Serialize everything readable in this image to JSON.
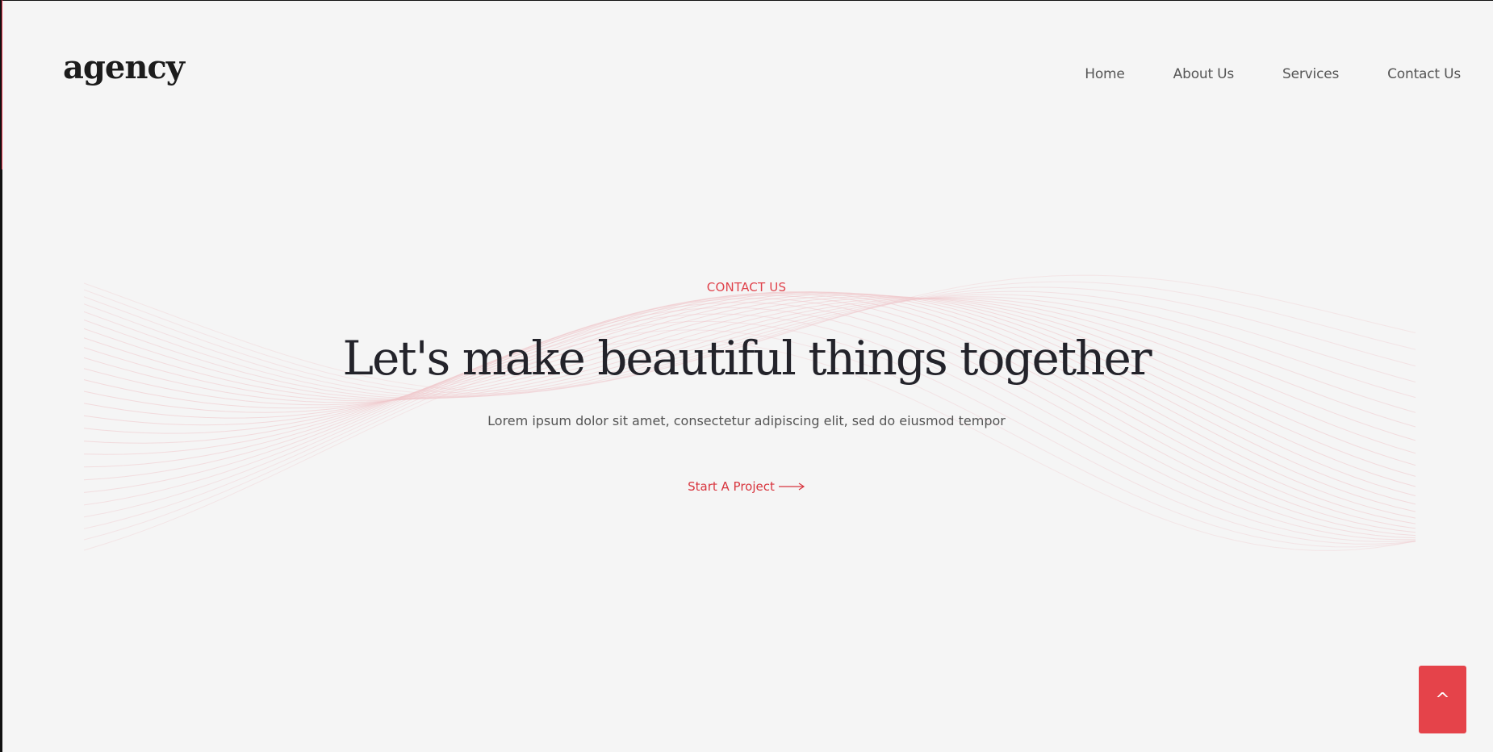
{
  "brand": {
    "logo_text": "agency"
  },
  "nav": {
    "items": [
      {
        "label": "Home"
      },
      {
        "label": "About Us"
      },
      {
        "label": "Services"
      },
      {
        "label": "Contact Us"
      }
    ]
  },
  "hero": {
    "eyebrow": "CONTACT US",
    "headline": "Let's make beautiful things together",
    "subtext": "Lorem ipsum dolor sit amet, consectetur adipiscing elit, sed do eiusmod tempor",
    "cta_label": "Start A Project"
  },
  "scroll_top": {
    "label": "^"
  },
  "colors": {
    "background": "#f5f5f5",
    "accent": "#e0434c",
    "text": "#23232a",
    "wave": "#f0c8cc"
  },
  "icons": {
    "cta_icon": "arrow-right-icon",
    "scroll_top_icon": "caret-up-icon"
  }
}
